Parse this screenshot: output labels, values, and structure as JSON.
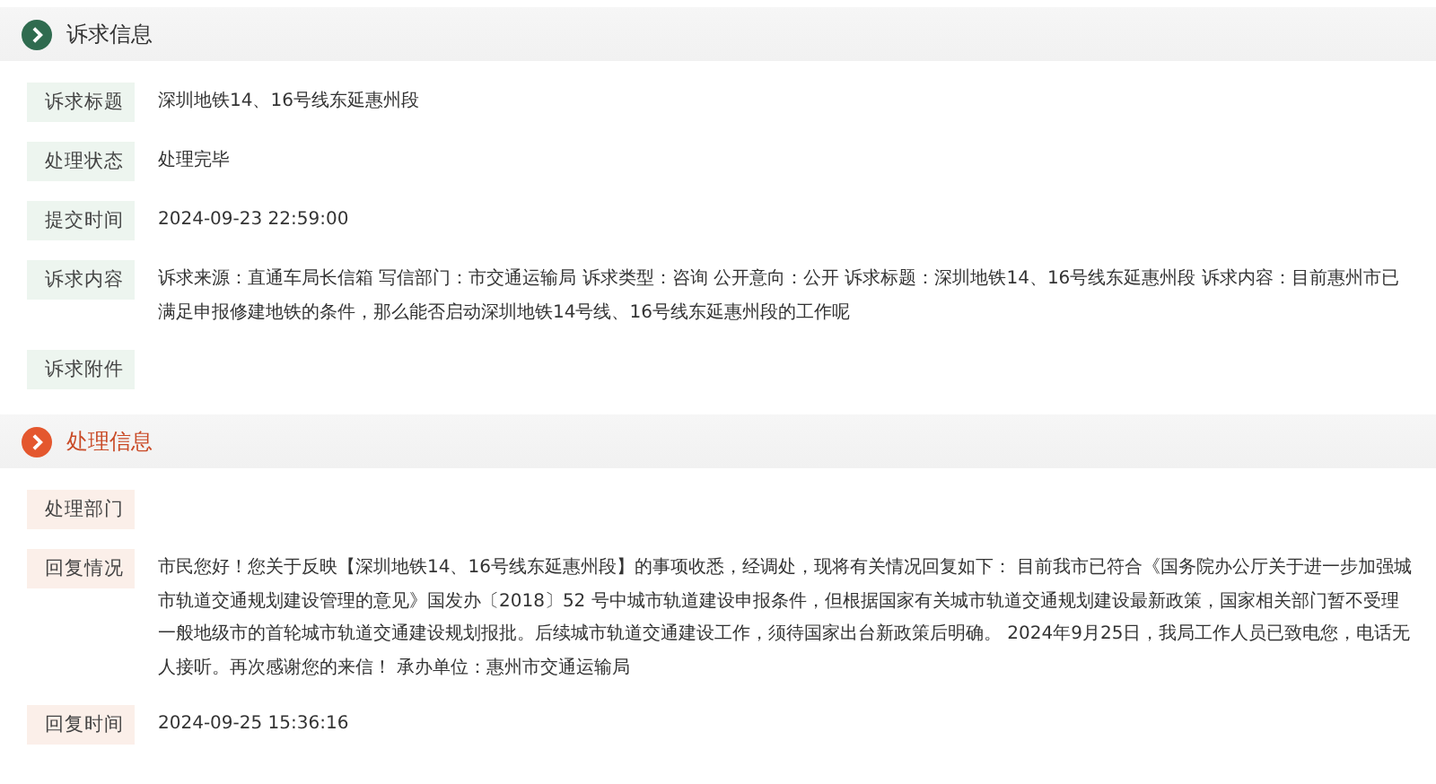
{
  "sections": [
    {
      "kind": "request",
      "title": "诉求信息",
      "fields": [
        {
          "label": "诉求标题",
          "value": "深圳地铁14、16号线东延惠州段"
        },
        {
          "label": "处理状态",
          "value": "处理完毕"
        },
        {
          "label": "提交时间",
          "value": "2024-09-23 22:59:00"
        },
        {
          "label": "诉求内容",
          "value": "诉求来源：直通车局长信箱 写信部门：市交通运输局 诉求类型：咨询 公开意向：公开 诉求标题：深圳地铁14、16号线东延惠州段 诉求内容：目前惠州市已满足申报修建地铁的条件，那么能否启动深圳地铁14号线、16号线东延惠州段的工作呢"
        },
        {
          "label": "诉求附件"
        }
      ]
    },
    {
      "kind": "handling",
      "title": "处理信息",
      "fields": [
        {
          "label": "处理部门"
        },
        {
          "label": "回复情况",
          "value": "市民您好！您关于反映【深圳地铁14、16号线东延惠州段】的事项收悉，经调处，现将有关情况回复如下： 目前我市已符合《国务院办公厅关于进一步加强城市轨道交通规划建设管理的意见》国发办〔2018〕52 号中城市轨道建设申报条件，但根据国家有关城市轨道交通规划建设最新政策，国家相关部门暂不受理一般地级市的首轮城市轨道交通建设规划报批。后续城市轨道交通建设工作，须待国家出台新政策后明确。 2024年9月25日，我局工作人员已致电您，电话无人接听。再次感谢您的来信！ 承办单位：惠州市交通运输局"
        },
        {
          "label": "回复时间",
          "value": "2024-09-25 15:36:16"
        }
      ]
    }
  ]
}
